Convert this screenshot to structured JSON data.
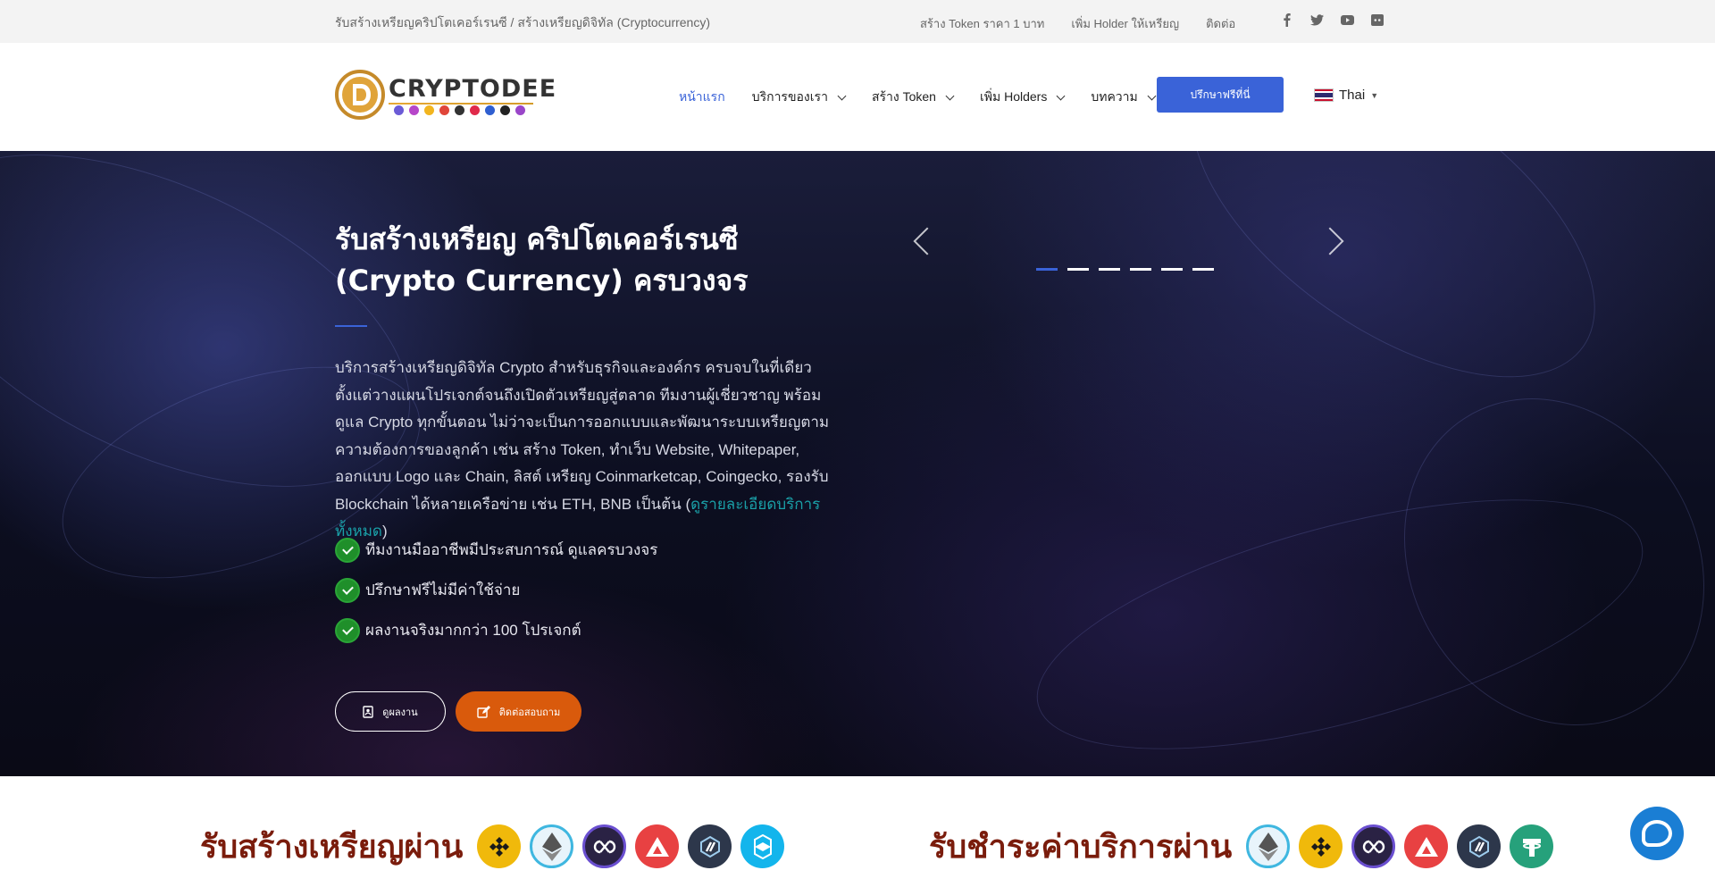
{
  "topbar": {
    "tagline": "รับสร้างเหรียญคริปโตเคอร์เรนซี / สร้างเหรียญดิจิทัล (Cryptocurrency)",
    "links": [
      "สร้าง Token ราคา 1 บาท",
      "เพิ่ม Holder ให้เหรียญ",
      "ติดต่อ"
    ],
    "socials": [
      "facebook-icon",
      "twitter-icon",
      "youtube-icon",
      "discord-icon"
    ]
  },
  "header": {
    "brand": "CRYPTODEE",
    "nav": [
      {
        "label": "หน้าแรก",
        "active": true,
        "dropdown": false
      },
      {
        "label": "บริการของเรา",
        "active": false,
        "dropdown": true
      },
      {
        "label": "สร้าง Token",
        "active": false,
        "dropdown": true
      },
      {
        "label": "เพิ่ม Holders",
        "active": false,
        "dropdown": true
      },
      {
        "label": "บทความ",
        "active": false,
        "dropdown": true
      }
    ],
    "cta": "ปรึกษาฟรีที่นี่",
    "language": "Thai"
  },
  "hero": {
    "title": "รับสร้างเหรียญ คริปโตเคอร์เรนซี (Crypto Currency) ครบวงจร",
    "desc_main": "บริการสร้างเหรียญดิจิทัล Crypto สำหรับธุรกิจและองค์กร ครบจบในที่เดียว ตั้งแต่วางแผนโปรเจกต์จนถึงเปิดตัวเหรียญสู่ตลาด ทีมงานผู้เชี่ยวชาญ พร้อมดูแล Crypto ทุกขั้นตอน ไม่ว่าจะเป็นการออกแบบและพัฒนาระบบเหรียญตามความต้องการของลูกค้า เช่น สร้าง Token, ทำเว็บ Website, Whitepaper, ออกแบบ Logo และ Chain, ลิสต์ เหรียญ Coinmarketcap, Coingecko, รองรับ Blockchain ได้หลายเครือข่าย เช่น ETH, BNB เป็นต้น (",
    "desc_link": "ดูรายละเอียดบริการทั้งหมด",
    "desc_close": ")",
    "checks": [
      "ทีมงานมืออาชีพมีประสบการณ์ ดูแลครบวงจร",
      "ปรึกษาฟรีไม่มีค่าใช้จ่าย",
      "ผลงานจริงมากกว่า 100 โปรเจกต์"
    ],
    "btn_outline": "ดูผลงาน",
    "btn_orange": "ติดต่อสอบถาม",
    "slider_dots": 6,
    "slider_active": 0
  },
  "banner": {
    "left_label": "รับสร้างเหรียญผ่าน",
    "left_coins": [
      "bnb-icon",
      "ethereum-icon",
      "polygon-icon",
      "avalanche-icon",
      "arbitrum-icon",
      "fantom-icon"
    ],
    "right_label": "รับชำระค่าบริการผ่าน",
    "right_coins": [
      "ethereum-icon",
      "bnb-icon",
      "polygon-icon",
      "avalanche-icon",
      "arbitrum-icon",
      "tether-icon"
    ]
  },
  "colors": {
    "accent": "#3a63d8",
    "orange": "#d95a0c",
    "check_green": "#1f8f2a",
    "banner_text": "#7a1c0c"
  }
}
